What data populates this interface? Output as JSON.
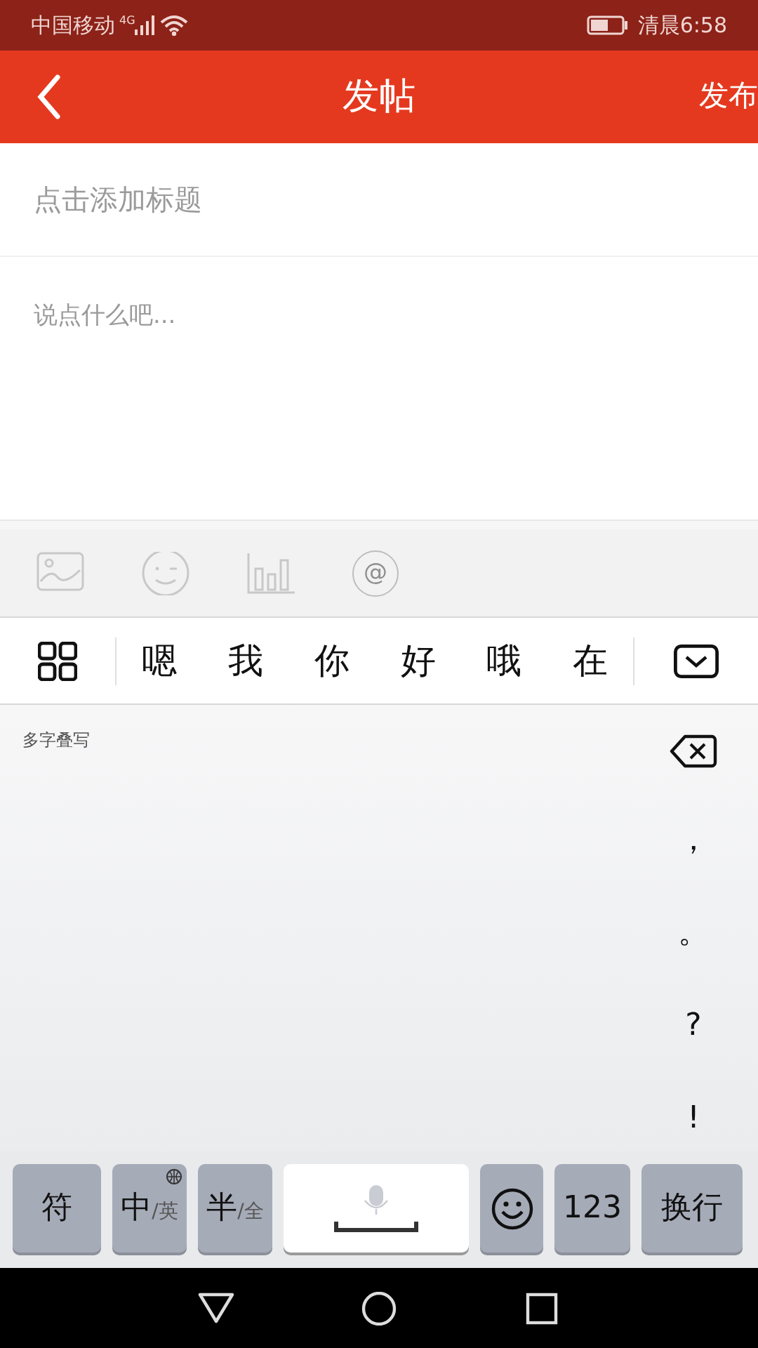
{
  "status_bar": {
    "carrier": "中国移动",
    "network": "4G",
    "time": "清晨6:58"
  },
  "header": {
    "title": "发帖",
    "action": "发布"
  },
  "form": {
    "title_placeholder": "点击添加标题",
    "body_placeholder": "说点什么吧..."
  },
  "toolbar": [
    {
      "kind": "image"
    },
    {
      "kind": "emoji"
    },
    {
      "kind": "chart"
    },
    {
      "kind": "mention",
      "label": "@"
    }
  ],
  "candidates": [
    "嗯",
    "我",
    "你",
    "好",
    "哦",
    "在"
  ],
  "keyboard": {
    "mode_label": "多字叠写",
    "punctuation": [
      "，",
      "。",
      "?",
      "!"
    ],
    "keys": [
      {
        "kind": "text",
        "label": "符"
      },
      {
        "kind": "split",
        "label": "中",
        "sub": "/英"
      },
      {
        "kind": "split",
        "label": "半",
        "sub": "/全"
      },
      {
        "kind": "space"
      },
      {
        "kind": "emoji"
      },
      {
        "kind": "text",
        "label": "123"
      },
      {
        "kind": "text",
        "label": "换行"
      }
    ]
  }
}
